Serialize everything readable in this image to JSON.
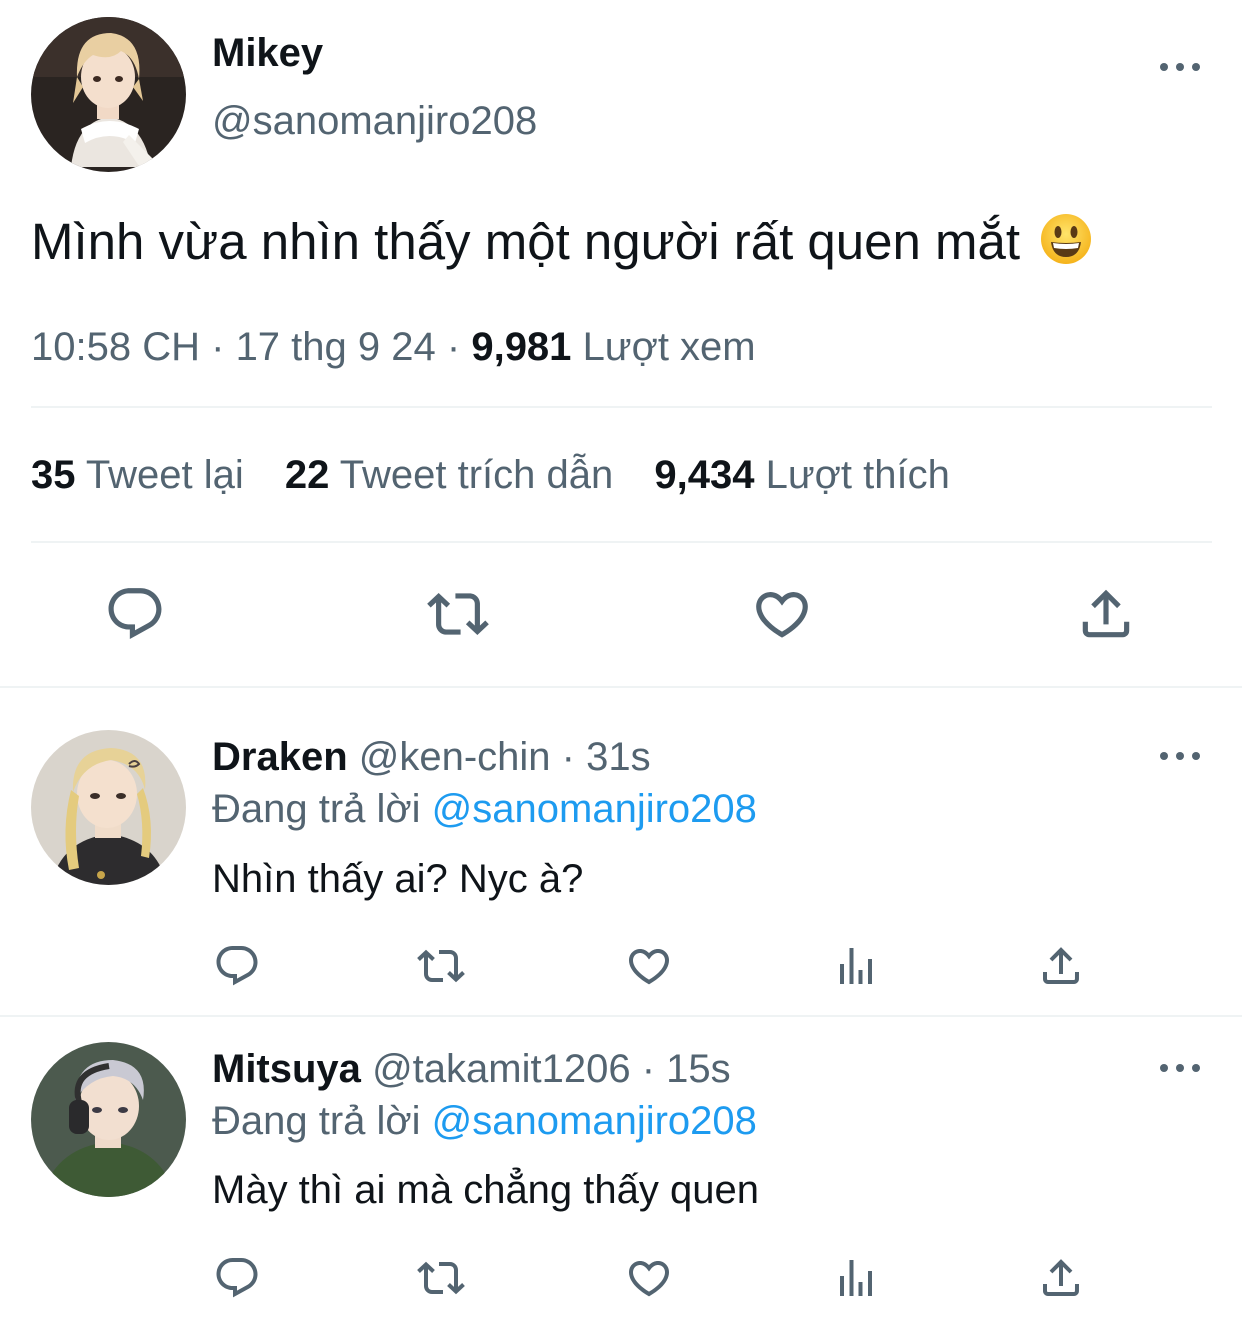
{
  "tweet": {
    "author_name": "Mikey",
    "author_handle": "@sanomanjiro208",
    "text": "Mình vừa nhìn thấy một người rất quen mắt",
    "emoji": "😀",
    "time": "10:58 CH",
    "date": "17 thg 9 24",
    "separator": "·",
    "views_count": "9,981",
    "views_label": "Lượt xem",
    "stats": {
      "retweets_count": "35",
      "retweets_label": "Tweet lại",
      "quotes_count": "22",
      "quotes_label": "Tweet trích dẫn",
      "likes_count": "9,434",
      "likes_label": "Lượt thích"
    }
  },
  "replies": [
    {
      "author_name": "Draken",
      "author_handle": "@ken-chin",
      "time": "31s",
      "replying_prefix": "Đang trả lời",
      "replying_to": "@sanomanjiro208",
      "text": "Nhìn thấy ai? Nyc à?"
    },
    {
      "author_name": "Mitsuya",
      "author_handle": "@takamit1206",
      "time": "15s",
      "replying_prefix": "Đang trả lời",
      "replying_to": "@sanomanjiro208",
      "text": "Mày thì ai mà chẳng thấy quen"
    }
  ],
  "icons": [
    "reply-icon",
    "retweet-icon",
    "like-icon",
    "share-icon",
    "views-icon",
    "more-icon"
  ],
  "colors": {
    "text": "#0f1419",
    "muted": "#536471",
    "link": "#1d9bf0",
    "divider": "#eff3f4"
  }
}
